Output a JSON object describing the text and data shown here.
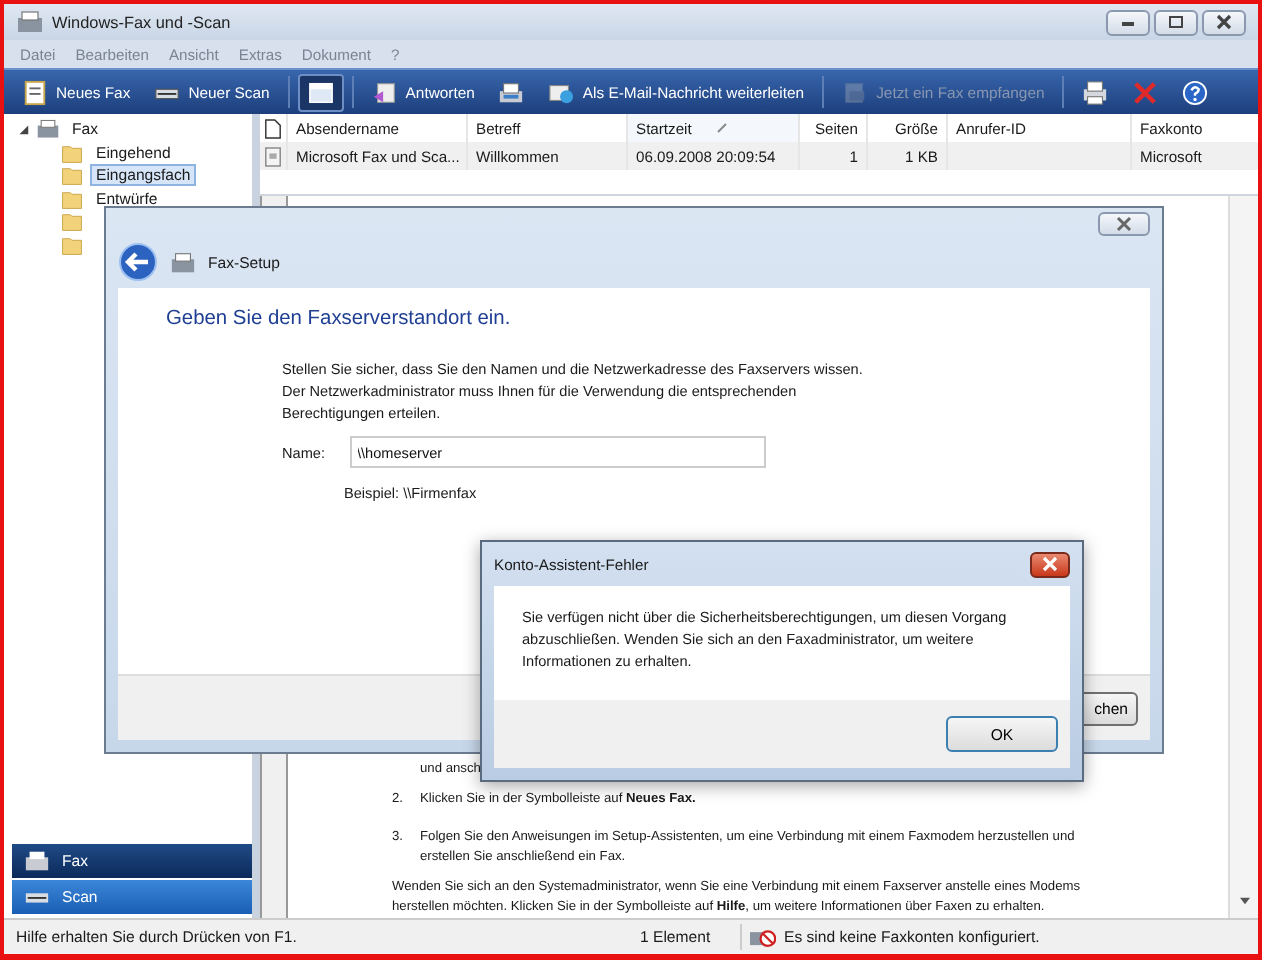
{
  "window": {
    "title": "Windows-Fax und -Scan"
  },
  "menu": [
    "Datei",
    "Bearbeiten",
    "Ansicht",
    "Extras",
    "Dokument",
    "?"
  ],
  "toolbar": [
    {
      "kind": "button",
      "label": "Neues Fax",
      "pressed": false,
      "disabled": false
    },
    {
      "kind": "button",
      "label": "Neuer Scan",
      "pressed": false,
      "disabled": false
    },
    {
      "kind": "separator"
    },
    {
      "kind": "button",
      "pressed": true,
      "disabled": false
    },
    {
      "kind": "separator"
    },
    {
      "kind": "button",
      "label": "Antworten",
      "pressed": false,
      "disabled": false
    },
    {
      "kind": "button",
      "pressed": false,
      "disabled": false
    },
    {
      "kind": "button",
      "label": "Als E-Mail-Nachricht weiterleiten",
      "pressed": false,
      "disabled": false
    },
    {
      "kind": "separator"
    },
    {
      "kind": "button",
      "label": "Jetzt ein Fax empfangen",
      "pressed": false,
      "disabled": true
    },
    {
      "kind": "separator"
    },
    {
      "kind": "button",
      "pressed": false,
      "disabled": false
    },
    {
      "kind": "button",
      "pressed": false,
      "disabled": false
    },
    {
      "kind": "button",
      "pressed": false,
      "disabled": false
    }
  ],
  "tree": {
    "label": "Fax",
    "expanded": true,
    "children": [
      {
        "label": "Eingehend",
        "selected": false
      },
      {
        "label": "Eingangsfach",
        "selected": true
      },
      {
        "label": "Entwürfe",
        "selected": false
      },
      {
        "selected": false
      },
      {
        "selected": false
      }
    ]
  },
  "nav_buttons": [
    {
      "label": "Fax",
      "selected": true
    },
    {
      "label": "Scan",
      "selected": false
    }
  ],
  "table": {
    "columns": [
      {
        "label": "Absendername",
        "sorted": false
      },
      {
        "label": "Betreff",
        "sorted": false
      },
      {
        "label": "Startzeit",
        "sorted": true
      },
      {
        "label": "Seiten",
        "sorted": false
      },
      {
        "label": "Größe",
        "sorted": false
      },
      {
        "label": "Anrufer-ID",
        "sorted": false
      },
      {
        "label": "Faxkonto",
        "sorted": false
      }
    ],
    "rows": [
      {
        "cells": [
          "Microsoft Fax und Sca...",
          "Willkommen",
          "06.09.2008 20:09:54",
          "1",
          "1 KB",
          "",
          "Microsoft"
        ]
      }
    ]
  },
  "preview": [
    {
      "kind": "fragment",
      "text": "und ansch"
    },
    {
      "kind": "step",
      "number": "2.",
      "text": "Klicken Sie in der Symbolleiste auf **Neues Fax.**"
    },
    {
      "kind": "step",
      "number": "3.",
      "text": "Folgen Sie den Anweisungen im Setup-Assistenten, um eine Verbindung mit einem Faxmodem herzustellen und erstellen Sie anschließend ein Fax."
    },
    {
      "kind": "paragraph",
      "text": "Wenden Sie sich an den Systemadministrator, wenn Sie eine Verbindung mit einem Faxserver anstelle eines Modems herstellen möchten. Klicken Sie in der Symbolleiste auf **Hilfe**, um weitere Informationen über Faxen zu erhalten."
    }
  ],
  "setup_dialog": {
    "title": "Fax-Setup",
    "heading": "Geben Sie den Faxserverstandort ein.",
    "description": [
      "Stellen Sie sicher, dass Sie den Namen und die Netzwerkadresse des Faxservers wissen.",
      "Der Netzwerkadministrator muss Ihnen für die Verwendung die entsprechenden Berechtigungen erteilen."
    ],
    "name_label": "Name:",
    "name_value": "\\\\homeserver",
    "example": "Beispiel: \\\\Firmenfax",
    "button": "chen"
  },
  "error_dialog": {
    "title": "Konto-Assistent-Fehler",
    "message": "Sie verfügen nicht über die Sicherheitsberechtigungen, um diesen Vorgang abzuschließen. Wenden Sie sich an den Faxadministrator, um weitere Informationen zu erhalten.",
    "button": "OK"
  },
  "status_bar": {
    "help": "Hilfe erhalten Sie durch Drücken von F1.",
    "count": "1 Element",
    "message": "Es sind keine Faxkonten konfiguriert."
  }
}
